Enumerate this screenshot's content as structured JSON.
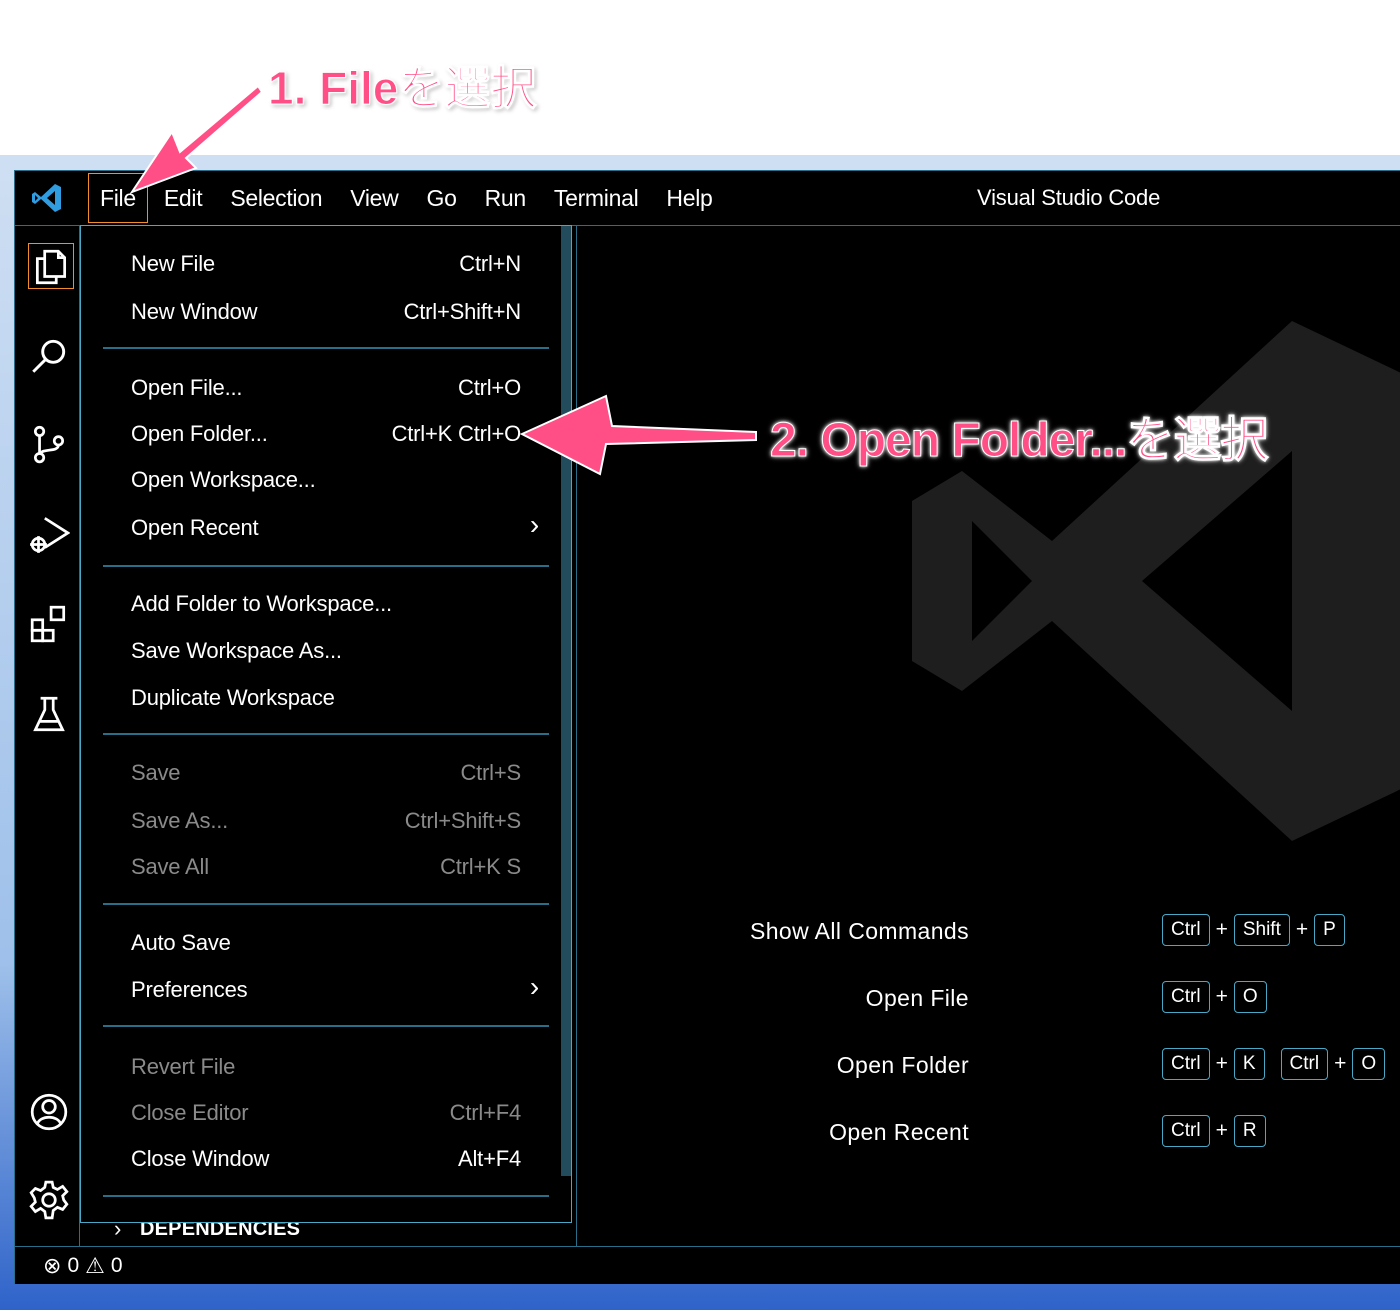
{
  "annotations": {
    "step1": "1. Fileを選択",
    "step2": "2. Open Folder...を選択"
  },
  "titlebar": {
    "menus": [
      "File",
      "Edit",
      "Selection",
      "View",
      "Go",
      "Run",
      "Terminal",
      "Help"
    ],
    "window_title": "Visual Studio Code"
  },
  "file_menu": {
    "items": [
      {
        "label": "New File",
        "shortcut": "Ctrl+N"
      },
      {
        "label": "New Window",
        "shortcut": "Ctrl+Shift+N"
      },
      {
        "label": "Open File...",
        "shortcut": "Ctrl+O"
      },
      {
        "label": "Open Folder...",
        "shortcut": "Ctrl+K Ctrl+O"
      },
      {
        "label": "Open Workspace...",
        "shortcut": ""
      },
      {
        "label": "Open Recent",
        "shortcut": "",
        "submenu_glyph": "›"
      },
      {
        "label": "Add Folder to Workspace...",
        "shortcut": ""
      },
      {
        "label": "Save Workspace As...",
        "shortcut": ""
      },
      {
        "label": "Duplicate Workspace",
        "shortcut": ""
      },
      {
        "label": "Save",
        "shortcut": "Ctrl+S",
        "disabled": true
      },
      {
        "label": "Save As...",
        "shortcut": "Ctrl+Shift+S",
        "disabled": true
      },
      {
        "label": "Save All",
        "shortcut": "Ctrl+K S",
        "disabled": true
      },
      {
        "label": "Auto Save",
        "shortcut": ""
      },
      {
        "label": "Preferences",
        "shortcut": "",
        "submenu_glyph": "›"
      },
      {
        "label": "Revert File",
        "shortcut": "",
        "disabled": true
      },
      {
        "label": "Close Editor",
        "shortcut": "Ctrl+F4",
        "disabled": true
      },
      {
        "label": "Close Window",
        "shortcut": "Alt+F4"
      }
    ]
  },
  "sidebar": {
    "section": "DEPENDENCIES",
    "chevron": "›"
  },
  "welcome_shortcuts": [
    {
      "label": "Show All Commands",
      "keys": [
        "Ctrl",
        "+",
        "Shift",
        "+",
        "P"
      ]
    },
    {
      "label": "Open File",
      "keys": [
        "Ctrl",
        "+",
        "O"
      ]
    },
    {
      "label": "Open Folder",
      "keys": [
        "Ctrl",
        "+",
        "K",
        " ",
        "Ctrl",
        "+",
        "O"
      ]
    },
    {
      "label": "Open Recent",
      "keys": [
        "Ctrl",
        "+",
        "R"
      ]
    }
  ],
  "statusbar": {
    "errors": "0",
    "warnings": "0",
    "error_icon": "⊗",
    "warning_icon": "⚠"
  },
  "colors": {
    "annotation": "#ff4f86",
    "border": "#2a6f8a",
    "focus": "#f28d2e",
    "keycap": "#4aa8c7"
  }
}
